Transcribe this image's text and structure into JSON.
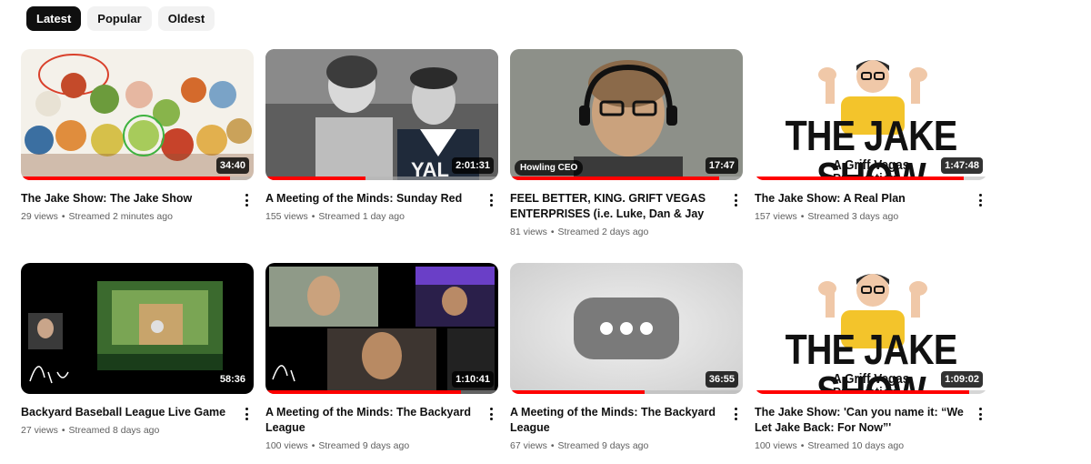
{
  "filter_chips": [
    {
      "label": "Latest",
      "active": true
    },
    {
      "label": "Popular",
      "active": false
    },
    {
      "label": "Oldest",
      "active": false
    }
  ],
  "videos": [
    {
      "title": "The Jake Show: The Jake Show",
      "views": "29 views",
      "streamed": "Streamed 2 minutes ago",
      "duration": "34:40",
      "watched_fraction": 0.9
    },
    {
      "title": "A Meeting of the Minds: Sunday Red",
      "views": "155 views",
      "streamed": "Streamed 1 day ago",
      "duration": "2:01:31",
      "watched_fraction": 0.43
    },
    {
      "title": "FEEL BETTER, KING. GRIFT VEGAS ENTERPRISES (i.e. Luke, Dan & Jay",
      "views": "81 views",
      "streamed": "Streamed 2 days ago",
      "duration": "17:47",
      "watched_fraction": 0.9,
      "thumb_label": "Howling CEO"
    },
    {
      "title": "The Jake Show: A Real Plan",
      "views": "157 views",
      "streamed": "Streamed 3 days ago",
      "duration": "1:47:48",
      "watched_fraction": 0.9
    },
    {
      "title": "Backyard Baseball League Live Game",
      "views": "27 views",
      "streamed": "Streamed 8 days ago",
      "duration": "58:36",
      "watched_fraction": 0.0
    },
    {
      "title": "A Meeting of the Minds: The Backyard League",
      "views": "100 views",
      "streamed": "Streamed 9 days ago",
      "duration": "1:10:41",
      "watched_fraction": 0.84
    },
    {
      "title": "A Meeting of the Minds: The Backyard League",
      "views": "67 views",
      "streamed": "Streamed 9 days ago",
      "duration": "36:55",
      "watched_fraction": 0.58
    },
    {
      "title": "The Jake Show: 'Can you name it: “We Let Jake Back: For Now”'",
      "views": "100 views",
      "streamed": "Streamed 10 days ago",
      "duration": "1:09:02",
      "watched_fraction": 0.92
    }
  ],
  "thumb_text": {
    "jake_show_line1": "THE JAKE SHOW",
    "jake_show_line2": "A Griff Vegas Production"
  },
  "colors": {
    "progress": "#ff0000",
    "chip_active_bg": "#0f0f0f",
    "chip_bg": "#f2f2f2",
    "meta_text": "#606060"
  }
}
